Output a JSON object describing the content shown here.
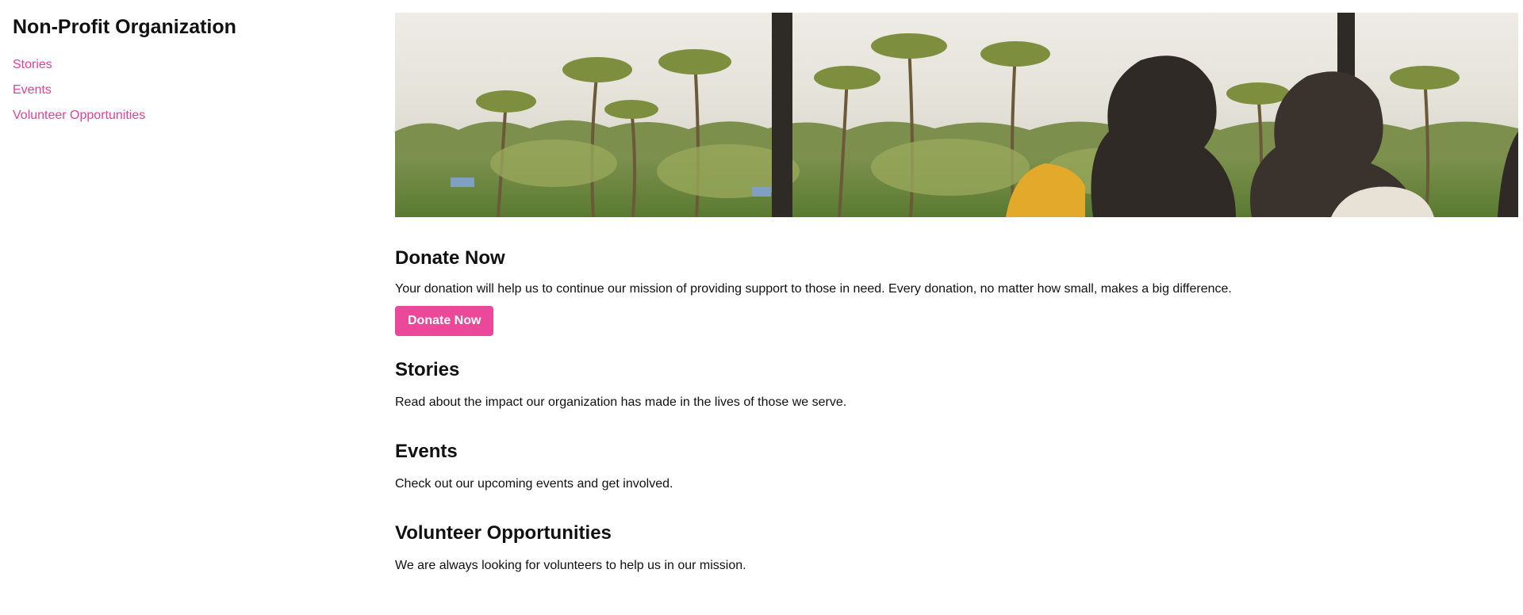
{
  "site": {
    "title": "Non-Profit Organization"
  },
  "nav": {
    "items": [
      {
        "label": "Stories"
      },
      {
        "label": "Events"
      },
      {
        "label": "Volunteer Opportunities"
      }
    ]
  },
  "donate": {
    "heading": "Donate Now",
    "text": "Your donation will help us to continue our mission of providing support to those in need. Every donation, no matter how small, makes a big difference.",
    "button_label": "Donate Now"
  },
  "stories": {
    "heading": "Stories",
    "text": "Read about the impact our organization has made in the lives of those we serve."
  },
  "events": {
    "heading": "Events",
    "text": "Check out our upcoming events and get involved."
  },
  "volunteer": {
    "heading": "Volunteer Opportunities",
    "text": "We are always looking for volunteers to help us in our mission."
  },
  "colors": {
    "accent": "#ec4899",
    "link": "#e0439a",
    "text": "#111111",
    "background": "#ffffff"
  }
}
